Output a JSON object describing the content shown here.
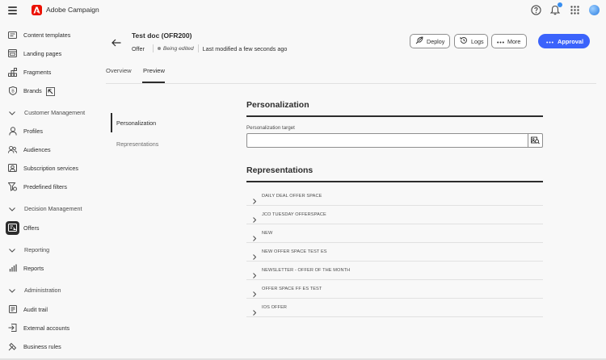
{
  "app": {
    "title": "Adobe Campaign"
  },
  "sidebar": {
    "items": [
      {
        "label": "Content templates",
        "icon": "content-templates-icon"
      },
      {
        "label": "Landing pages",
        "icon": "landing-pages-icon"
      },
      {
        "label": "Fragments",
        "icon": "fragments-icon"
      },
      {
        "label": "Brands",
        "icon": "brands-icon"
      }
    ],
    "sections": [
      {
        "label": "Customer Management",
        "items": [
          {
            "label": "Profiles"
          },
          {
            "label": "Audiences"
          },
          {
            "label": "Subscription services"
          },
          {
            "label": "Predefined filters"
          }
        ]
      },
      {
        "label": "Decision Management",
        "items": [
          {
            "label": "Offers"
          }
        ]
      },
      {
        "label": "Reporting",
        "items": [
          {
            "label": "Reports"
          }
        ]
      },
      {
        "label": "Administration",
        "items": [
          {
            "label": "Audit trail"
          },
          {
            "label": "External accounts"
          },
          {
            "label": "Business rules"
          }
        ]
      }
    ]
  },
  "header": {
    "title": "Test doc (OFR200)",
    "type": "Offer",
    "status": "Being edited",
    "modified": "Last modified a few seconds ago",
    "buttons": {
      "deploy": "Deploy",
      "logs": "Logs",
      "more": "More",
      "approval": "Approval"
    }
  },
  "tabs": [
    {
      "label": "Overview"
    },
    {
      "label": "Preview"
    }
  ],
  "subnav": [
    {
      "label": "Personalization"
    },
    {
      "label": "Representations"
    }
  ],
  "personalization": {
    "title": "Personalization",
    "target_label": "Personalization target",
    "target_value": ""
  },
  "representations": {
    "title": "Representations",
    "items": [
      "DAILY DEAL OFFER SPACE",
      "JCO TUESDAY OFFERSPACE",
      "NEW",
      "NEW OFFER SPACE TEST ES",
      "NEWSLETTER - OFFER OF THE MONTH",
      "OFFER SPACE FF ES TEST",
      "IOS OFFER"
    ]
  },
  "colors": {
    "accent": "#3b63fb",
    "logo": "#eb1000"
  }
}
